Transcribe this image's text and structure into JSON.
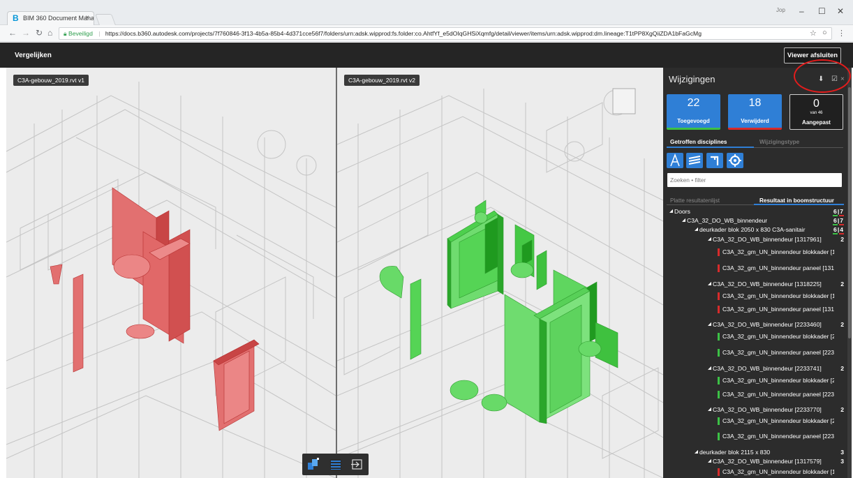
{
  "browser": {
    "tab_title": "BIM 360 Document Mana",
    "tab_close": "×",
    "tab_logo": "B",
    "user_label": "Jop",
    "window_controls": [
      "–",
      "☐",
      "✕"
    ],
    "secure_label": "Beveiligd",
    "url": "https://docs.b360.autodesk.com/projects/7f760846-3f13-4b5a-85b4-4d371cce56f7/folders/urn:adsk.wipprod:fs.folder:co.AhtfYf_e5dOIqGHSiXqmfg/detail/viewer/items/urn:adsk.wipprod:dm.lineage:T1tPP8XgQiiZDA1bFaGcMg"
  },
  "header": {
    "title": "Vergelijken",
    "close_viewer": "Viewer afsluiten"
  },
  "viewers": {
    "left_label": "C3A-gebouw_2019.rvt v1",
    "right_label": "C3A-gebouw_2019.rvt v2"
  },
  "panel": {
    "title": "Wijzigingen",
    "stats": {
      "added": {
        "value": "22",
        "label": "Toegevoegd"
      },
      "removed": {
        "value": "18",
        "label": "Verwijderd"
      },
      "modified": {
        "value": "0",
        "sub": "van 46",
        "label": "Aangepast"
      }
    },
    "tabs_top": [
      "Getroffen disciplines",
      "Wijzigingstype"
    ],
    "disciplines": [
      "architecture-icon",
      "structure-icon",
      "plumbing-icon",
      "mechanical-icon"
    ],
    "search_placeholder": "Zoeken • filter",
    "tabs_results": [
      "Platte resultatenlijst",
      "Resultaat in boomstructuur"
    ],
    "tree": [
      {
        "label": "Doors",
        "indent": 0,
        "count_a": "6",
        "count_b": "7",
        "type": "node"
      },
      {
        "label": "C3A_32_DO_WB_binnendeur",
        "indent": 1,
        "count_a": "6",
        "count_b": "7",
        "type": "node"
      },
      {
        "label": "deurkader blok 2050 x 830 C3A-sanitair",
        "indent": 2,
        "count_a": "6",
        "count_b": "4",
        "type": "node"
      },
      {
        "label": "C3A_32_DO_WB_binnendeur [1317961]",
        "indent": 3,
        "count": "2",
        "type": "node"
      },
      {
        "label": "C3A_32_gm_UN_binnendeur blokkader [1",
        "indent": 4,
        "status": "removed",
        "type": "leaf"
      },
      {
        "label": "C3A_32_gm_UN_binnendeur paneel [1317",
        "indent": 4,
        "status": "removed",
        "type": "leaf"
      },
      {
        "label": "C3A_32_DO_WB_binnendeur [1318225]",
        "indent": 3,
        "count": "2",
        "type": "node"
      },
      {
        "label": "C3A_32_gm_UN_binnendeur blokkader [1",
        "indent": 4,
        "status": "removed",
        "type": "leaf"
      },
      {
        "label": "C3A_32_gm_UN_binnendeur paneel [1318",
        "indent": 4,
        "status": "removed",
        "type": "leaf"
      },
      {
        "label": "C3A_32_DO_WB_binnendeur [2233460]",
        "indent": 3,
        "count": "2",
        "type": "node"
      },
      {
        "label": "C3A_32_gm_UN_binnendeur blokkader [2",
        "indent": 4,
        "status": "added",
        "type": "leaf"
      },
      {
        "label": "C3A_32_gm_UN_binnendeur paneel [2233",
        "indent": 4,
        "status": "added",
        "type": "leaf"
      },
      {
        "label": "C3A_32_DO_WB_binnendeur [2233741]",
        "indent": 3,
        "count": "2",
        "type": "node"
      },
      {
        "label": "C3A_32_gm_UN_binnendeur blokkader [2",
        "indent": 4,
        "status": "added",
        "type": "leaf"
      },
      {
        "label": "C3A_32_gm_UN_binnendeur paneel [2233",
        "indent": 4,
        "status": "added",
        "type": "leaf"
      },
      {
        "label": "C3A_32_DO_WB_binnendeur [2233770]",
        "indent": 3,
        "count": "2",
        "type": "node"
      },
      {
        "label": "C3A_32_gm_UN_binnendeur blokkader [2",
        "indent": 4,
        "status": "added",
        "type": "leaf"
      },
      {
        "label": "C3A_32_gm_UN_binnendeur paneel [2233",
        "indent": 4,
        "status": "added",
        "type": "leaf"
      },
      {
        "label": "deurkader blok 2115 x 830",
        "indent": 2,
        "count": "3",
        "type": "node"
      },
      {
        "label": "C3A_32_DO_WB_binnendeur [1317579]",
        "indent": 3,
        "count": "3",
        "type": "node"
      },
      {
        "label": "C3A_32_gm_UN_binnendeur blokkader [1",
        "indent": 4,
        "status": "removed",
        "type": "leaf"
      }
    ]
  },
  "colors": {
    "accent": "#2f7fd6",
    "added": "#3cc146",
    "removed": "#d72b2b",
    "panel_bg": "#2c2c2c",
    "highlight": "#e41c1c"
  },
  "toolbar": [
    "split-view-icon",
    "list-view-icon",
    "exit-compare-icon"
  ]
}
